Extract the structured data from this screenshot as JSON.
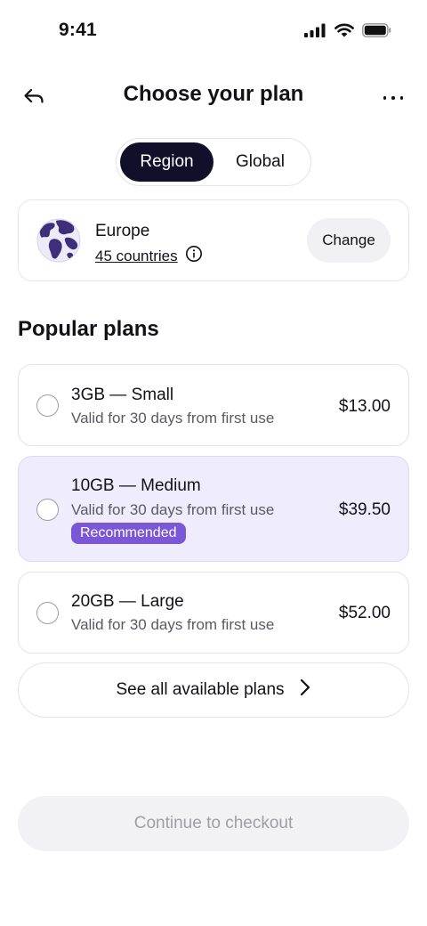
{
  "status_bar": {
    "time": "9:41",
    "icons": [
      "signal-icon",
      "wifi-icon",
      "battery-icon"
    ]
  },
  "header": {
    "title": "Choose your plan",
    "back_icon": "back-arrow-icon",
    "more_icon": "more-horizontal-icon"
  },
  "segmented": {
    "options": [
      "Region",
      "Global"
    ],
    "selected": "Region"
  },
  "region": {
    "name": "Europe",
    "countries": "45 countries",
    "info_icon": "info-icon",
    "change_label": "Change"
  },
  "popular": {
    "title": "Popular plans",
    "plans": [
      {
        "name": "3GB — Small",
        "validity": "Valid for 30 days from first use",
        "price": "$13.00",
        "selected": false
      },
      {
        "name": "10GB — Medium",
        "validity": "Valid for 30 days from first use",
        "price": "$39.50",
        "badge": "Recommended",
        "selected": false
      },
      {
        "name": "20GB — Large",
        "validity": "Valid for 30 days from first use",
        "price": "$52.00",
        "selected": false
      }
    ]
  },
  "see_all": {
    "label": "See all available plans"
  },
  "checkout": {
    "label": "Continue to checkout",
    "enabled": false
  },
  "colors": {
    "accent": "#7b57d8",
    "segment_active": "#120f2b",
    "highlight": "#efedfd"
  }
}
